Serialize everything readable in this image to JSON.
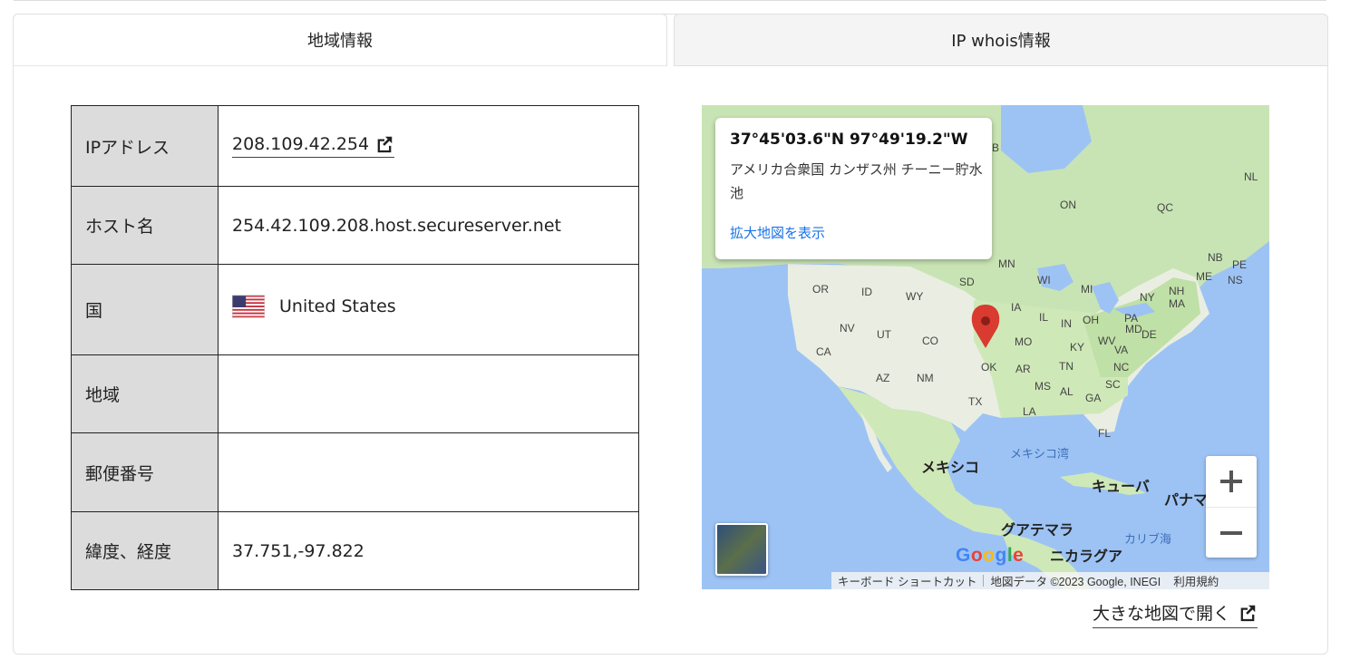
{
  "tabs": {
    "region_info": "地域情報",
    "whois": "IP whois情報"
  },
  "table": {
    "rows": [
      {
        "label": "IPアドレス",
        "value": "208.109.42.254"
      },
      {
        "label": "ホスト名",
        "value": "254.42.109.208.host.secureserver.net"
      },
      {
        "label": "国",
        "value": "United States"
      },
      {
        "label": "地域",
        "value": ""
      },
      {
        "label": "郵便番号",
        "value": ""
      },
      {
        "label": "緯度、経度",
        "value": "37.751,-97.822"
      }
    ]
  },
  "map": {
    "info_window": {
      "coordinates": "37°45'03.6\"N 97°49'19.2\"W",
      "address": "アメリカ合衆国 カンザス州 チーニー貯水池",
      "link": "拡大地図を表示"
    },
    "labels": {
      "ON": "ON",
      "QC": "QC",
      "NL": "NL",
      "NB": "NB",
      "PE": "PE",
      "NS": "NS",
      "ME": "ME",
      "MN": "MN",
      "WI": "WI",
      "MI": "MI",
      "NY": "NY",
      "NH": "NH",
      "MA": "MA",
      "SD": "SD",
      "OR": "OR",
      "ID": "ID",
      "WY": "WY",
      "IA": "IA",
      "IL": "IL",
      "IN": "IN",
      "OH": "OH",
      "PA": "PA",
      "NV": "NV",
      "UT": "UT",
      "CO": "CO",
      "MO": "MO",
      "KY": "KY",
      "WV": "WV",
      "VA": "VA",
      "MD": "MD",
      "DE": "DE",
      "CA": "CA",
      "AZ": "AZ",
      "NM": "NM",
      "OK": "OK",
      "AR": "AR",
      "TN": "TN",
      "NC": "NC",
      "TX": "TX",
      "MS": "MS",
      "AL": "AL",
      "GA": "GA",
      "SC": "SC",
      "LA": "LA",
      "FL": "FL",
      "B": "B",
      "gulf": "メキシコ湾",
      "mexico": "メキシコ",
      "cuba": "キューバ",
      "guatemala": "グアテマラ",
      "nicaragua": "ニカラグア",
      "caribbean": "カリブ海",
      "panama": "パナマ"
    },
    "google": "Google",
    "attribution": {
      "shortcuts": "キーボード ショートカット",
      "data": "地図データ ©2023 Google, INEGI",
      "terms": "利用規約"
    },
    "zoom_in": "+",
    "zoom_out": "−"
  },
  "open_big_map": "大きな地図で開く",
  "colors": {
    "label_bg": "#dcdcdc",
    "link_blue": "#1a73e8",
    "marker": "#d93b30",
    "ocean": "#aadaff",
    "land": "#c9e7b4"
  },
  "icons": [
    "external-link-icon",
    "us-flag-icon",
    "map-marker-icon",
    "plus-icon",
    "minus-icon"
  ]
}
